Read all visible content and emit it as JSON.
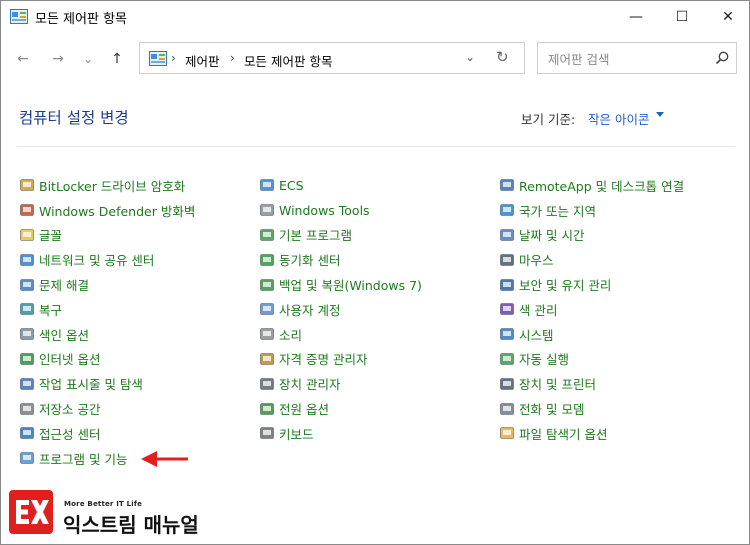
{
  "window": {
    "title": "모든 제어판 항목",
    "minimize_glyph": "—",
    "maximize_glyph": "☐",
    "close_glyph": "✕"
  },
  "nav": {
    "back_glyph": "←",
    "forward_glyph": "→",
    "recent_glyph": "⌄",
    "up_glyph": "↑"
  },
  "address": {
    "crumbs": [
      "제어판",
      "모든 제어판 항목"
    ],
    "separator": "›",
    "dropdown_glyph": "⌄",
    "refresh_glyph": "↻"
  },
  "search": {
    "placeholder": "제어판 검색"
  },
  "header": {
    "title": "컴퓨터 설정 변경",
    "view_label": "보기 기준:",
    "view_value": "작은 아이콘"
  },
  "columns": [
    [
      {
        "label": "BitLocker 드라이브 암호화",
        "icon": "bitlocker-icon"
      },
      {
        "label": "Windows Defender 방화벽",
        "icon": "firewall-icon"
      },
      {
        "label": "글꼴",
        "icon": "fonts-icon"
      },
      {
        "label": "네트워크 및 공유 센터",
        "icon": "network-icon"
      },
      {
        "label": "문제 해결",
        "icon": "troubleshoot-icon"
      },
      {
        "label": "복구",
        "icon": "recovery-icon"
      },
      {
        "label": "색인 옵션",
        "icon": "indexing-icon"
      },
      {
        "label": "인터넷 옵션",
        "icon": "internet-options-icon"
      },
      {
        "label": "작업 표시줄 및 탐색",
        "icon": "taskbar-icon"
      },
      {
        "label": "저장소 공간",
        "icon": "storage-icon"
      },
      {
        "label": "접근성 센터",
        "icon": "accessibility-icon"
      },
      {
        "label": "프로그램 및 기능",
        "icon": "programs-icon"
      }
    ],
    [
      {
        "label": "ECS",
        "icon": "ecs-icon"
      },
      {
        "label": "Windows Tools",
        "icon": "windows-tools-icon"
      },
      {
        "label": "기본 프로그램",
        "icon": "default-programs-icon"
      },
      {
        "label": "동기화 센터",
        "icon": "sync-icon"
      },
      {
        "label": "백업 및 복원(Windows 7)",
        "icon": "backup-icon"
      },
      {
        "label": "사용자 계정",
        "icon": "user-accounts-icon"
      },
      {
        "label": "소리",
        "icon": "sound-icon"
      },
      {
        "label": "자격 증명 관리자",
        "icon": "credential-icon"
      },
      {
        "label": "장치 관리자",
        "icon": "device-manager-icon"
      },
      {
        "label": "전원 옵션",
        "icon": "power-icon"
      },
      {
        "label": "키보드",
        "icon": "keyboard-icon"
      }
    ],
    [
      {
        "label": "RemoteApp 및 데스크톱 연결",
        "icon": "remoteapp-icon"
      },
      {
        "label": "국가 또는 지역",
        "icon": "region-icon"
      },
      {
        "label": "날짜 및 시간",
        "icon": "datetime-icon"
      },
      {
        "label": "마우스",
        "icon": "mouse-icon"
      },
      {
        "label": "보안 및 유지 관리",
        "icon": "security-icon"
      },
      {
        "label": "색 관리",
        "icon": "color-management-icon"
      },
      {
        "label": "시스템",
        "icon": "system-icon"
      },
      {
        "label": "자동 실행",
        "icon": "autoplay-icon"
      },
      {
        "label": "장치 및 프린터",
        "icon": "printers-icon"
      },
      {
        "label": "전화 및 모뎀",
        "icon": "phone-modem-icon"
      },
      {
        "label": "파일 탐색기 옵션",
        "icon": "folder-options-icon"
      }
    ]
  ],
  "watermark": {
    "tagline": "More Better IT Life",
    "brand": "익스트림 매뉴얼"
  },
  "colors": {
    "link_green": "#1d7a1d",
    "title_blue": "#1a3e8e",
    "accent_blue": "#1c61c9",
    "arrow_red": "#e0201f"
  }
}
